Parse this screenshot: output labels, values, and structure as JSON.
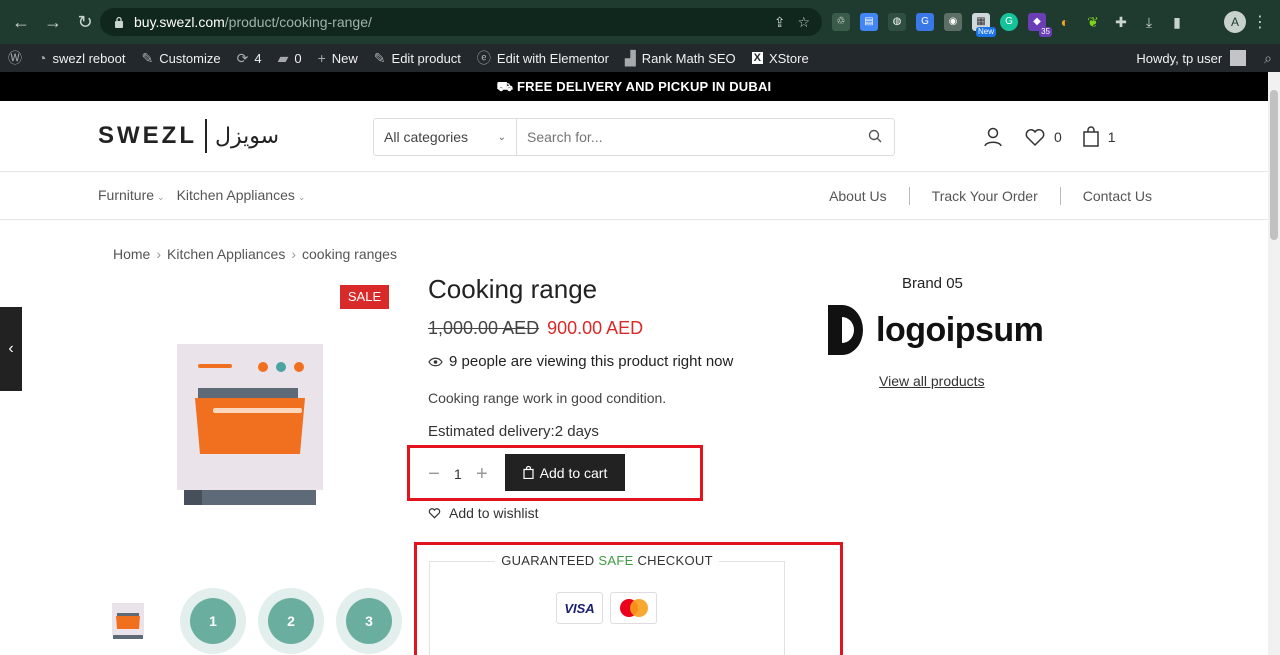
{
  "browser": {
    "url_domain": "buy.swezl.com",
    "url_path": "/product/cooking-range/",
    "profile_initial": "A",
    "ext_badge_new": "New",
    "ext_badge_count": "35"
  },
  "admin_bar": {
    "site_name": "swezl reboot",
    "customize": "Customize",
    "updates": "4",
    "comments": "0",
    "new": "New",
    "edit_product": "Edit product",
    "elementor": "Edit with Elementor",
    "rank_math": "Rank Math SEO",
    "xstore": "XStore",
    "howdy": "Howdy, tp user"
  },
  "promo": {
    "text": "FREE DELIVERY AND PICKUP IN DUBAI"
  },
  "header": {
    "logo_en": "SWEZL",
    "logo_ar": "سويزل",
    "category_select": "All categories",
    "search_placeholder": "Search for...",
    "wishlist_count": "0",
    "cart_count": "1"
  },
  "nav": {
    "left": [
      "Furniture",
      "Kitchen Appliances"
    ],
    "right": [
      "About Us",
      "Track Your Order",
      "Contact Us"
    ]
  },
  "breadcrumb": [
    "Home",
    "Kitchen Appliances",
    "cooking ranges"
  ],
  "product": {
    "sale_badge": "SALE",
    "title": "Cooking range",
    "old_price": "1,000.00 AED",
    "new_price": "900.00 AED",
    "viewing": "9 people are viewing this product right now",
    "description": "Cooking range work in good condition.",
    "delivery_label": "Estimated delivery:",
    "delivery_value": "2 days",
    "quantity": "1",
    "add_to_cart": "Add to cart",
    "wishlist": "Add to wishlist",
    "checkout_pre": "GUARANTEED ",
    "checkout_safe": "SAFE",
    "checkout_post": " CHECKOUT",
    "payment_visa": "VISA",
    "thumbs": [
      "1",
      "2",
      "3"
    ]
  },
  "brand": {
    "label": "Brand 05",
    "logo_text": "logoipsum",
    "view_all": "View all products"
  },
  "colors": {
    "chrome_bg": "#1f3a2e",
    "admin_bar_bg": "#23282d",
    "sale_red": "#d92a2a",
    "highlight_red": "#e2151f",
    "safe_green": "#3f9a3f",
    "oven_orange": "#f07020"
  }
}
